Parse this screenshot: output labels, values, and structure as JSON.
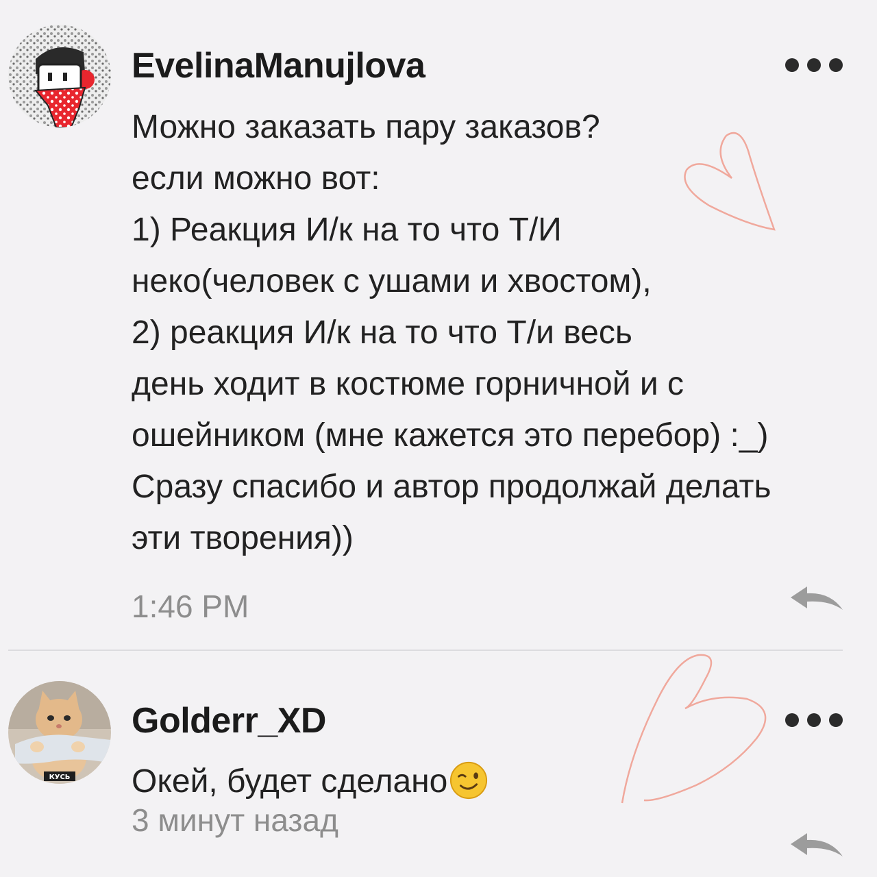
{
  "comments": [
    {
      "username": "EvelinaManujlova",
      "avatar_icon": "boy-with-red-polka-dot-scarf-icon",
      "text_lines": [
        "Можно заказать пару заказов?",
        "если можно вот:",
        "1) Реакция И/к на то что Т/И",
        "неко(человек с ушами и хвостом),",
        "2) реакция И/к на то что Т/и весь",
        "день ходит в костюме горничной и с",
        "ошейником (мне кажется это перебор) :_)",
        "Сразу спасибо и автор продолжай делать",
        "эти творения))"
      ],
      "timestamp": "1:46 PM",
      "more_icon": "more-dots-icon",
      "reply_icon": "reply-arrow-icon"
    },
    {
      "username": "Golderr_XD",
      "avatar_icon": "cat-photo-icon",
      "avatar_caption": "КУСЬ",
      "text": "Окей, будет сделано",
      "emoji": "winking-face-emoji",
      "timestamp": "3 минут назад",
      "more_icon": "more-dots-icon",
      "reply_icon": "reply-arrow-icon"
    }
  ],
  "colors": {
    "background": "#f3f2f4",
    "text": "#222222",
    "timestamp": "#8d8d8d",
    "heart_doodle": "#f0a89c"
  }
}
